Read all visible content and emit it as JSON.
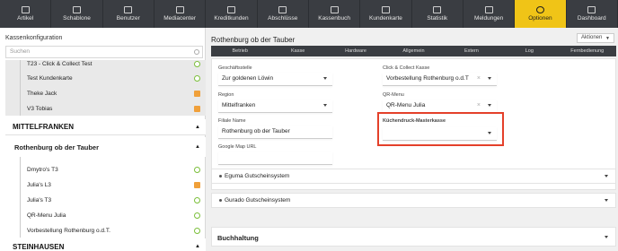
{
  "nav": [
    {
      "label": "Artikel",
      "icon": "tag-icon",
      "active": false
    },
    {
      "label": "Schablone",
      "icon": "template-icon",
      "active": false
    },
    {
      "label": "Benutzer",
      "icon": "users-icon",
      "active": false
    },
    {
      "label": "Mediacenter",
      "icon": "image-icon",
      "active": false
    },
    {
      "label": "Kreditkunden",
      "icon": "credit-card-icon",
      "active": false
    },
    {
      "label": "Abschlüsse",
      "icon": "report-icon",
      "active": false
    },
    {
      "label": "Kassenbuch",
      "icon": "book-icon",
      "active": false
    },
    {
      "label": "Kundenkarte",
      "icon": "card-icon",
      "active": false
    },
    {
      "label": "Statistik",
      "icon": "chart-icon",
      "active": false
    },
    {
      "label": "Meldungen",
      "icon": "message-icon",
      "active": false
    },
    {
      "label": "Optionen",
      "icon": "gear-icon",
      "active": true
    },
    {
      "label": "Dashboard",
      "icon": "monitor-icon",
      "active": false
    }
  ],
  "left": {
    "title": "Kassenkonfiguration",
    "search_placeholder": "Suchen",
    "top_items": [
      {
        "label": "T23 - Click & Collect Test",
        "marker": "circle"
      },
      {
        "label": "Test Kundenkarte",
        "marker": "circle"
      },
      {
        "label": "Theke Jack",
        "marker": "square"
      },
      {
        "label": "V3 Tobias",
        "marker": "square"
      }
    ],
    "group1": "MITTELFRANKEN",
    "location": "Rothenburg ob der Tauber",
    "location_items": [
      {
        "label": "Dmytro's T3",
        "marker": "circle"
      },
      {
        "label": "Julia's L3",
        "marker": "square"
      },
      {
        "label": "Julia's T3",
        "marker": "circle"
      },
      {
        "label": "QR-Menu Julia",
        "marker": "circle"
      },
      {
        "label": "Vorbestellung Rothenburg o.d.T.",
        "marker": "circle"
      }
    ],
    "group2": "STEINHAUSEN"
  },
  "right": {
    "title": "Rothenburg ob der Tauber",
    "aktionen": "Aktionen",
    "tabs": [
      "Betrieb",
      "Kasse",
      "Hardware",
      "Allgemein",
      "Extern",
      "Log",
      "Fernbedienung"
    ],
    "fields": {
      "geschaeftsstelle_label": "Geschäftsstelle",
      "geschaeftsstelle_value": "Zur goldenen Löwin",
      "cc_label": "Click & Collect Kasse",
      "cc_value": "Vorbestellung Rothenburg o.d.T",
      "region_label": "Region",
      "region_value": "Mittelfranken",
      "qr_label": "QR-Menu",
      "qr_value": "QR-Menu Julia",
      "filiale_label": "Filiale Name",
      "filiale_value": "Rothenburg ob der Tauber",
      "kd_label": "Küchendruck-Masterkasse",
      "kd_value": "",
      "gmap_label": "Google Map URL",
      "gmap_value": ""
    },
    "collapsibles": [
      "Eguma Gutscheinsystem",
      "Gurado Gutscheinsystem"
    ],
    "section": "Buchhaltung"
  },
  "colors": {
    "accent": "#f0c417",
    "nav_bg": "#3a3d42",
    "highlight": "#e4402a"
  }
}
